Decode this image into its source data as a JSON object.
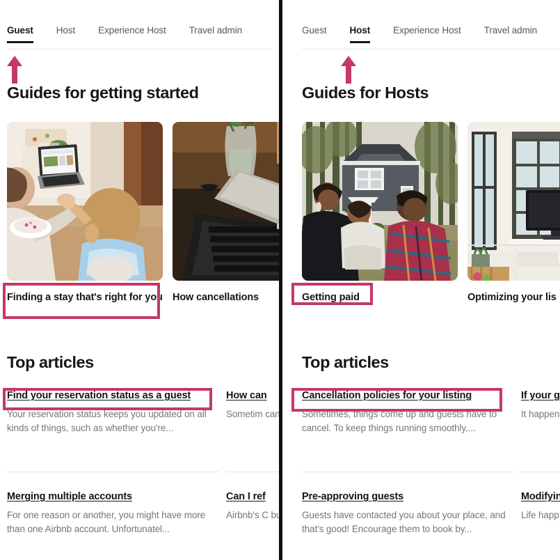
{
  "annotation": {
    "highlight_color": "#c4386b",
    "arrow_color": "#c4386b",
    "arrow_icon": "up-arrow-icon",
    "divider_color": "#111111"
  },
  "panels": [
    {
      "id": "guest",
      "tabs": [
        {
          "label": "Guest",
          "active": true
        },
        {
          "label": "Host",
          "active": false
        },
        {
          "label": "Experience Host",
          "active": false
        },
        {
          "label": "Travel admin",
          "active": false
        }
      ],
      "guides_heading": "Guides for getting started",
      "guide_cards": [
        {
          "caption": "Finding a stay that's right for you",
          "image_name": "family-at-laptop-photo",
          "highlighted": true
        },
        {
          "caption": "How cancellations",
          "image_name": "laptop-and-notebook-photo",
          "highlighted": false
        }
      ],
      "top_articles_heading": "Top articles",
      "articles": [
        {
          "title": "Find your reservation status as a guest",
          "desc": "Your reservation status keeps you updated on all kinds of things, such as whether you're...",
          "highlighted": true
        },
        {
          "title": "How can",
          "desc": "Sometim cancel. To",
          "highlighted": false
        },
        {
          "title": "Merging multiple accounts",
          "desc": "For one reason or another, you might have more than one Airbnb account. Unfortunatel...",
          "highlighted": false
        },
        {
          "title": "Can I ref",
          "desc": "Airbnb's C but you c",
          "highlighted": false
        }
      ]
    },
    {
      "id": "host",
      "tabs": [
        {
          "label": "Guest",
          "active": false
        },
        {
          "label": "Host",
          "active": true
        },
        {
          "label": "Experience Host",
          "active": false
        },
        {
          "label": "Travel admin",
          "active": false
        }
      ],
      "guides_heading": "Guides for Hosts",
      "guide_cards": [
        {
          "caption": "Getting paid",
          "image_name": "family-in-front-of-cabin-photo",
          "highlighted": true
        },
        {
          "caption": "Optimizing your lis",
          "image_name": "home-office-desk-photo",
          "highlighted": false
        }
      ],
      "top_articles_heading": "Top articles",
      "articles": [
        {
          "title": "Cancellation policies for your listing",
          "desc": "Sometimes, things come up and guests have to cancel. To keep things running smoothly,...",
          "highlighted": true
        },
        {
          "title": "If your g",
          "desc": "It happen cancel th",
          "highlighted": false
        },
        {
          "title": "Pre-approving guests",
          "desc": "Guests have contacted you about your place, and that's good! Encourage them to book by...",
          "highlighted": false
        },
        {
          "title": "Modifyin",
          "desc": "Life happ host as p",
          "highlighted": false
        }
      ]
    }
  ]
}
